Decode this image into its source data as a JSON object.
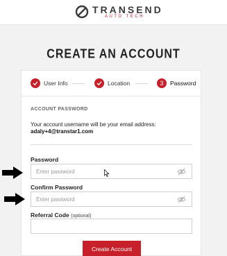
{
  "brand": {
    "name": "TRANSEND",
    "tagline": "AUTO TECH"
  },
  "page_title": "CREATE AN ACCOUNT",
  "steps": [
    {
      "label": "User Info",
      "state": "complete"
    },
    {
      "label": "Location",
      "state": "complete"
    },
    {
      "label": "Password",
      "number": "3",
      "state": "active"
    }
  ],
  "section": {
    "title": "ACCOUNT PASSWORD",
    "notice": "Your account username will be your email address:",
    "email": "adaly+4@transtar1.com"
  },
  "fields": {
    "password": {
      "label": "Password",
      "placeholder": "Enter password",
      "value": ""
    },
    "confirm": {
      "label": "Confirm Password",
      "placeholder": "Enter password",
      "value": ""
    },
    "referral": {
      "label": "Referral Code",
      "optional": "(optional)",
      "value": ""
    }
  },
  "submit_label": "Create Account",
  "colors": {
    "accent": "#c8202a",
    "background": "#f2f2f2"
  }
}
